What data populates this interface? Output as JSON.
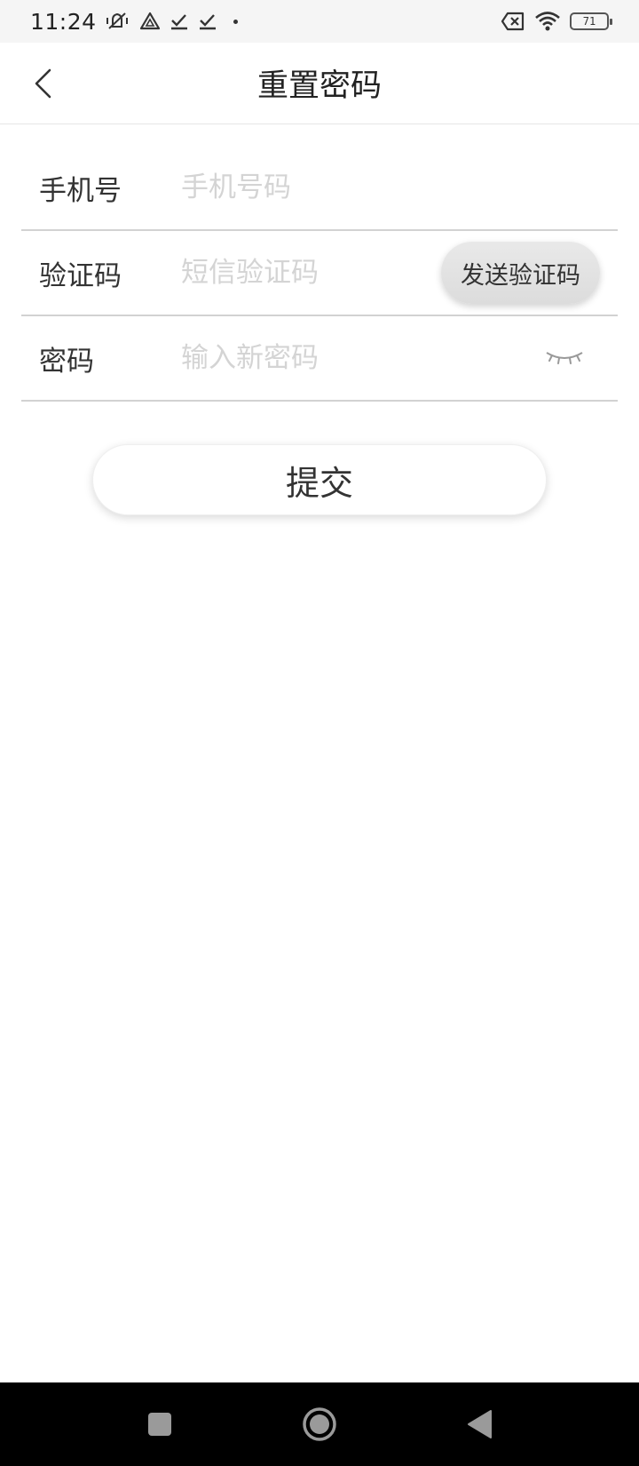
{
  "status_bar": {
    "time": "11:24",
    "battery_level": "71",
    "icons": [
      "mute-vibrate-icon",
      "drive-icon",
      "download-done-icon",
      "download-done-icon",
      "dot-icon",
      "no-sim-icon",
      "wifi-icon",
      "battery-icon"
    ]
  },
  "header": {
    "title": "重置密码",
    "back_icon": "chevron-left-icon"
  },
  "form": {
    "phone": {
      "label": "手机号",
      "placeholder": "手机号码",
      "value": ""
    },
    "code": {
      "label": "验证码",
      "placeholder": "短信验证码",
      "value": "",
      "send_button_label": "发送验证码"
    },
    "password": {
      "label": "密码",
      "placeholder": "输入新密码",
      "value": "",
      "toggle_icon": "eye-closed-icon"
    }
  },
  "submit": {
    "label": "提交"
  },
  "system_nav": {
    "recents_icon": "square-icon",
    "home_icon": "circle-icon",
    "back_icon": "triangle-back-icon"
  },
  "colors": {
    "placeholder": "#d4d4d4",
    "divider": "#d2d2d2",
    "text": "#333333",
    "nav_bar": "#000000",
    "nav_keys": "#9a9a9a"
  }
}
